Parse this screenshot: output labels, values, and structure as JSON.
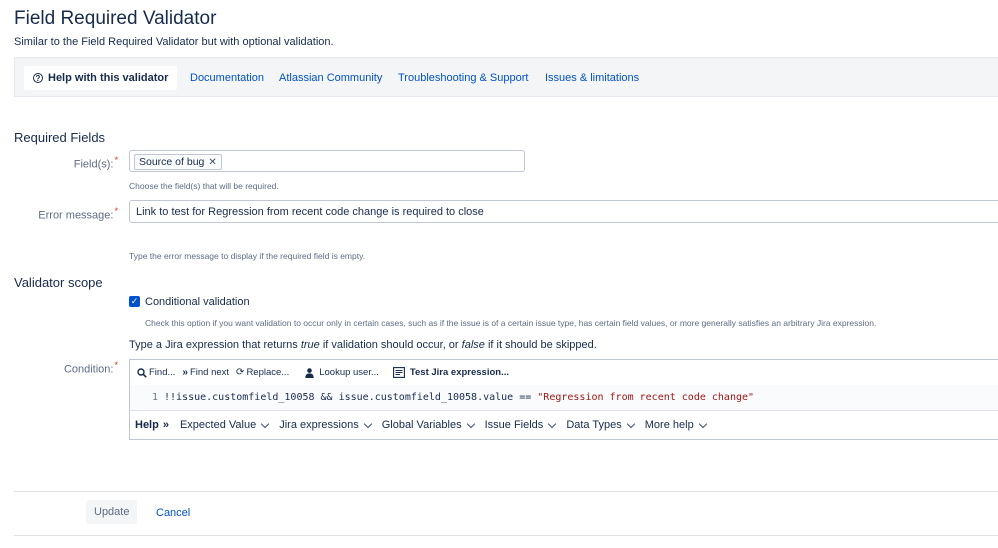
{
  "header": {
    "title": "Field Required Validator",
    "subtitle": "Similar to the Field Required Validator but with optional validation."
  },
  "tabs": [
    {
      "label": "Help with this validator",
      "active": true
    },
    {
      "label": "Documentation"
    },
    {
      "label": "Atlassian Community"
    },
    {
      "label": "Troubleshooting & Support"
    },
    {
      "label": "Issues & limitations"
    }
  ],
  "required_fields": {
    "heading": "Required Fields",
    "fields_label": "Field(s):",
    "fields_value": "Source of bug",
    "fields_help": "Choose the field(s) that will be required.",
    "error_label": "Error message:",
    "error_value": "Link to test for Regression from recent code change is required to close",
    "error_help": "Type the error message to display if the required field is empty."
  },
  "validator_scope": {
    "heading": "Validator scope",
    "conditional_label": "Conditional validation",
    "conditional_checked": true,
    "conditional_help": "Check this option if you want validation to occur only in certain cases, such as if the issue is of a certain issue type, has certain field values, or more generally satisfies an arbitrary Jira expression.",
    "expr_intro_a": "Type a Jira expression that returns ",
    "expr_intro_true": "true",
    "expr_intro_b": " if validation should occur, or ",
    "expr_intro_false": "false",
    "expr_intro_c": " if it should be skipped.",
    "condition_label": "Condition:"
  },
  "editor": {
    "toolbar": {
      "find": "Find...",
      "find_next": "Find next",
      "replace": "Replace...",
      "lookup_user": "Lookup user...",
      "test_expression": "Test Jira expression..."
    },
    "line_number": "1",
    "code_prefix": "!!issue.customfield_10058 && issue.customfield_10058.value == ",
    "code_string": "\"Regression from recent code change\"",
    "helpbar": {
      "help": "Help",
      "arrows": "»",
      "items": [
        "Expected Value",
        "Jira expressions",
        "Global Variables",
        "Issue Fields",
        "Data Types",
        "More help"
      ]
    }
  },
  "footer": {
    "update_label": "Update",
    "cancel_label": "Cancel"
  },
  "colors": {
    "link": "#0052cc",
    "required_asterisk": "#de350b",
    "checkbox": "#0052cc",
    "code_string": "#a31515"
  }
}
